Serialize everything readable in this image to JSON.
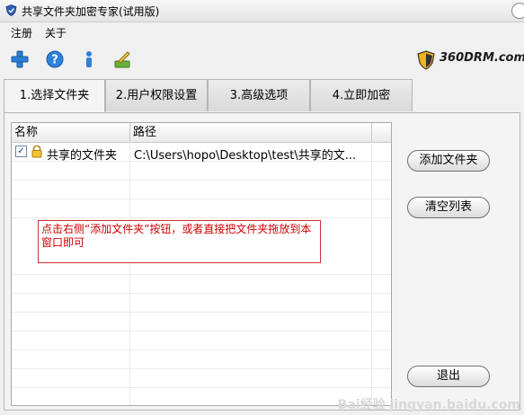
{
  "window": {
    "title": "共享文件夹加密专家(试用版)"
  },
  "menu": {
    "items": [
      {
        "label": "注册"
      },
      {
        "label": "关于"
      }
    ]
  },
  "toolbar": {
    "icons": [
      "add-icon",
      "help-icon",
      "info-icon",
      "edit-icon"
    ],
    "brand": "360DRM.com"
  },
  "tabs": [
    {
      "label": "1.选择文件夹",
      "active": true
    },
    {
      "label": "2.用户权限设置",
      "active": false
    },
    {
      "label": "3.高级选项",
      "active": false
    },
    {
      "label": "4.立即加密",
      "active": false
    }
  ],
  "list": {
    "columns": [
      "名称",
      "路径"
    ],
    "rows": [
      {
        "checked": true,
        "name": "共享的文件夹",
        "path": "C:\\Users\\hopo\\Desktop\\test\\共享的文..."
      }
    ]
  },
  "hint": "点击右侧“添加文件夹”按钮，或者直接把文件夹拖放到本窗口即可",
  "buttons": {
    "add": "添加文件夹",
    "clear": "清空列表",
    "exit": "退出"
  },
  "watermark": "Bai经验 jingyan.baidu.com"
}
